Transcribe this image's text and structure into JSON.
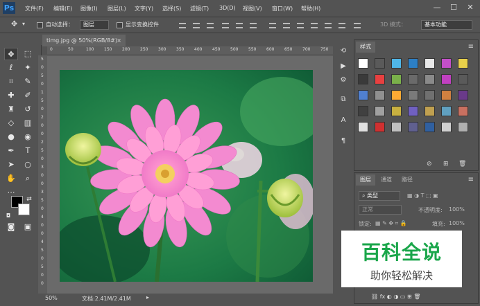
{
  "app": {
    "logo": "Ps"
  },
  "menu": [
    "文件(F)",
    "编辑(E)",
    "图像(I)",
    "图层(L)",
    "文字(Y)",
    "选择(S)",
    "滤镜(T)",
    "3D(D)",
    "视图(V)",
    "窗口(W)",
    "帮助(H)"
  ],
  "window_controls": {
    "minimize": "—",
    "maximize": "☐",
    "close": "✕"
  },
  "options": {
    "auto_select_label": "自动选择：",
    "auto_select_value": "图层",
    "transform_label": "显示变换控件",
    "mode_3d_label": "3D 模式：",
    "workspace": "基本功能"
  },
  "document": {
    "tab": "timg.jpg @ 50%(RGB/8#)",
    "tab_close": "×",
    "zoom": "50%",
    "doc_size": "文档:2.41M/2.41M"
  },
  "ruler_h": [
    "0",
    "50",
    "100",
    "150",
    "200",
    "250",
    "300",
    "350",
    "400",
    "450",
    "500",
    "550",
    "600",
    "650",
    "700",
    "750"
  ],
  "ruler_v": [
    "5",
    "0",
    "5",
    "0",
    "1",
    "5",
    "0",
    "2",
    "0",
    "0",
    "2",
    "5",
    "0",
    "3",
    "0",
    "0",
    "3",
    "5",
    "0",
    "4",
    "0",
    "0",
    "4",
    "5",
    "0",
    "5",
    "0",
    "0"
  ],
  "styles_panel": {
    "tab": "样式",
    "menu_icon": "≡",
    "swatch_colors": [
      "#ffffff",
      "#5a5a5a",
      "#4fb6e8",
      "#2d7fc4",
      "#e8e8e8",
      "#c34fc8",
      "#e8d04a",
      "#3a3a3a",
      "#e84040",
      "#7ab04a",
      "#6a6a6a",
      "#8a8a8a",
      "#c040c0",
      "#5a5a5a",
      "#5080d0",
      "#909090",
      "#ffaa33",
      "#7a7a7a",
      "#707070",
      "#d08040",
      "#6a3a8a",
      "#404040",
      "#a0a0a0",
      "#c8b040",
      "#7060c0",
      "#c0a050",
      "#60a0c0",
      "#c87060",
      "#e0e0e0",
      "#d03030",
      "#c0c0c0",
      "#606090",
      "#3060a0",
      "#d0d0d0",
      "#b0b0b0"
    ]
  },
  "layers_panel": {
    "tabs": [
      "图层",
      "通道",
      "路径"
    ],
    "kind_label": "类型",
    "blend_mode": "正常",
    "opacity_label": "不透明度:",
    "opacity_value": "100%",
    "lock_label": "锁定:",
    "fill_label": "填充:",
    "fill_value": "100%"
  },
  "watermark": {
    "title": "百科全说",
    "subtitle": "助你轻松解决"
  }
}
